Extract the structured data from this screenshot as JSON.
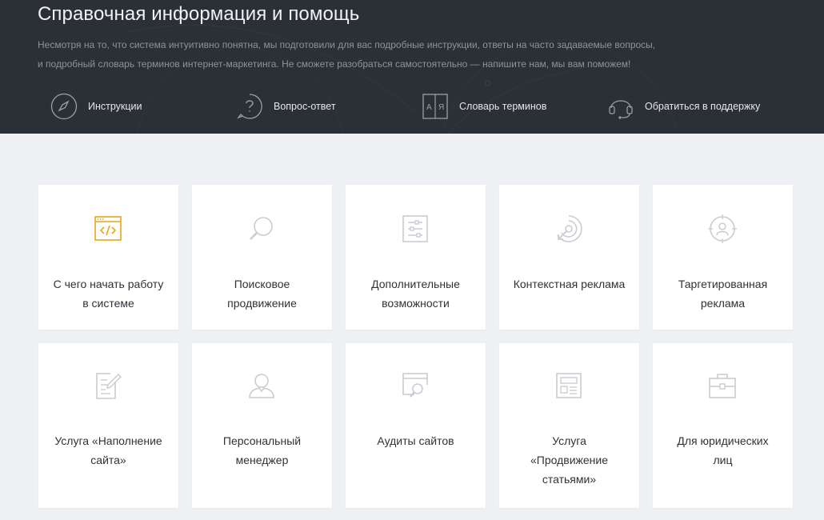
{
  "header": {
    "title": "Справочная информация и помощь",
    "desc_line1": "Несмотря на то, что система интуитивно понятна, мы подготовили для вас подробные инструкции, ответы на часто задаваемые вопросы,",
    "desc_line2": "и подробный словарь терминов интернет-маркетинга. Не сможете разобраться самостоятельно — напишите нам, мы вам поможем!"
  },
  "nav": [
    {
      "label": "Инструкции",
      "icon": "compass-icon"
    },
    {
      "label": "Вопрос-ответ",
      "icon": "question-icon"
    },
    {
      "label": "Словарь терминов",
      "icon": "dictionary-icon"
    },
    {
      "label": "Обратиться в поддержку",
      "icon": "headset-icon"
    }
  ],
  "cards": [
    {
      "line1": "С чего начать работу",
      "line2": "в системе",
      "line3": "",
      "icon": "code-window-icon",
      "active": true
    },
    {
      "line1": "Поисковое",
      "line2": "продвижение",
      "line3": "",
      "icon": "search-icon"
    },
    {
      "line1": "Дополнительные",
      "line2": "возможности",
      "line3": "",
      "icon": "sliders-icon"
    },
    {
      "line1": "Контекстная реклама",
      "line2": "",
      "line3": "",
      "icon": "target-click-icon"
    },
    {
      "line1": "Таргетированная",
      "line2": "реклама",
      "line3": "",
      "icon": "user-target-icon"
    },
    {
      "line1": "Услуга «Наполнение",
      "line2": "сайта»",
      "line3": "",
      "icon": "edit-document-icon"
    },
    {
      "line1": "Персональный",
      "line2": "менеджер",
      "line3": "",
      "icon": "person-icon"
    },
    {
      "line1": "Аудиты сайтов",
      "line2": "",
      "line3": "",
      "icon": "audit-icon"
    },
    {
      "line1": "Услуга",
      "line2": "«Продвижение",
      "line3": "статьями»",
      "icon": "article-icon"
    },
    {
      "line1": "Для юридических",
      "line2": "лиц",
      "line3": "",
      "icon": "briefcase-icon"
    }
  ],
  "colors": {
    "accent": "#e6a617",
    "icon_muted": "#c9ccd2",
    "header_bg": "#2b2f36"
  }
}
